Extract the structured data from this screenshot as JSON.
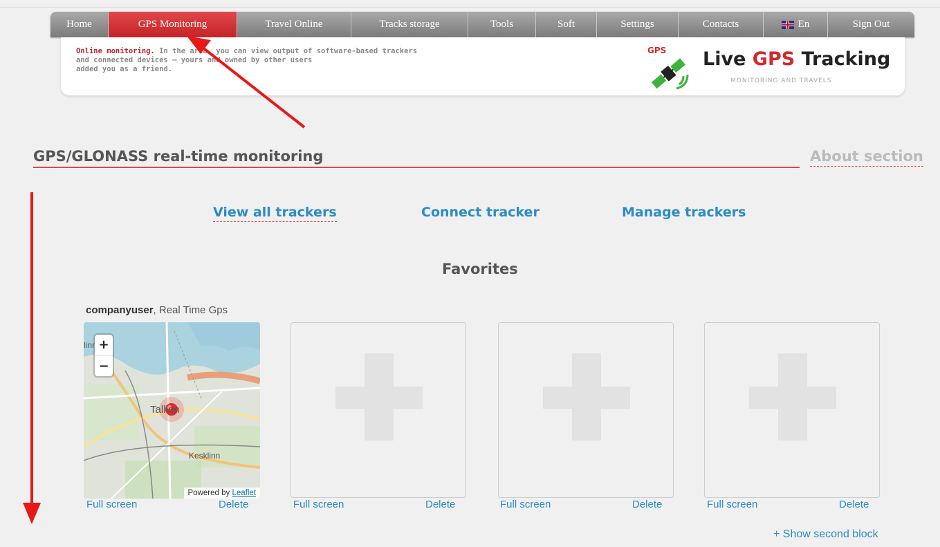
{
  "nav": {
    "items": [
      {
        "label": "Home",
        "active": false
      },
      {
        "label": "GPS Monitoring",
        "active": true
      },
      {
        "label": "Travel Online",
        "active": false
      },
      {
        "label": "Tracks storage",
        "active": false
      },
      {
        "label": "Tools",
        "active": false
      },
      {
        "label": "Soft",
        "active": false
      },
      {
        "label": "Settings",
        "active": false
      },
      {
        "label": "Contacts",
        "active": false
      },
      {
        "label": "En",
        "active": false,
        "icon": "uk-flag-icon"
      },
      {
        "label": "Sign Out",
        "active": false
      }
    ]
  },
  "header": {
    "intro_highlight": "Online monitoring.",
    "intro_line1": "In the area, you can view output of software-based trackers",
    "intro_line2": "and connected devices — yours and owned by other users",
    "intro_line3": "added you as a friend.",
    "logo_badge": "GPS",
    "logo_title_1": "Live ",
    "logo_title_2": "GPS",
    "logo_title_3": " Tracking",
    "logo_subtitle": "MONITORING AND TRAVELS"
  },
  "section": {
    "title": "GPS/GLONASS real-time monitoring",
    "about_link": "About section"
  },
  "actions": {
    "view_all": "View all trackers",
    "connect": "Connect tracker",
    "manage": "Manage trackers"
  },
  "favorites": {
    "title": "Favorites",
    "card1_user": "companyuser",
    "card1_rest": ", Real Time Gps",
    "full_screen": "Full screen",
    "delete": "Delete",
    "show_second": "+ Show second block"
  },
  "map": {
    "zoom_in": "+",
    "zoom_out": "−",
    "label_city": "Tallinn",
    "label_district": "Kesklinn",
    "label_edge": "linn",
    "attribution_prefix": "Powered by ",
    "attribution_link": "Leaflet"
  },
  "colors": {
    "accent_red": "#c52327",
    "link_blue": "#2b8cc4",
    "annotation_red": "#e81818"
  }
}
